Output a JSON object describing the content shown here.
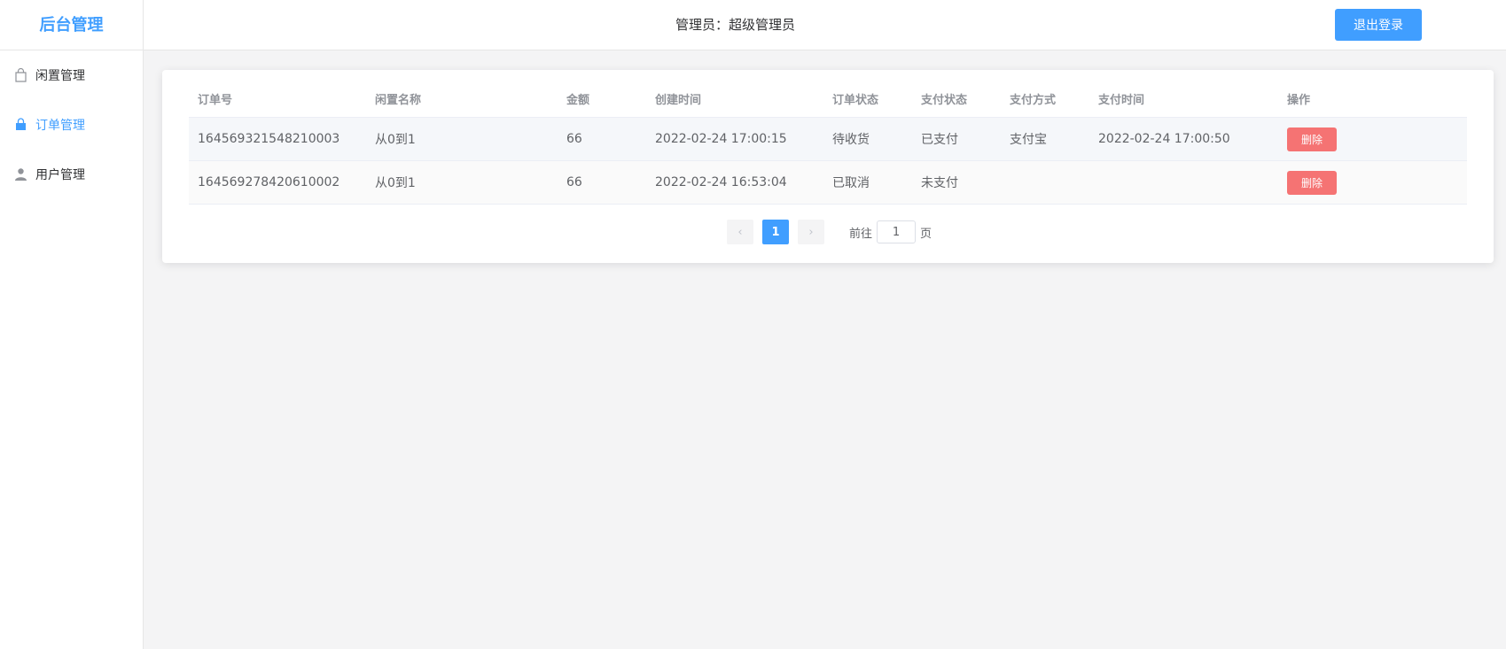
{
  "sidebar": {
    "title": "后台管理",
    "items": [
      {
        "label": "闲置管理",
        "icon": "shopping-bag-icon",
        "active": false
      },
      {
        "label": "订单管理",
        "icon": "shopping-bag-filled-icon",
        "active": true
      },
      {
        "label": "用户管理",
        "icon": "user-icon",
        "active": false
      }
    ]
  },
  "header": {
    "admin_label": "管理员：超级管理员",
    "logout_label": "退出登录"
  },
  "table": {
    "columns": [
      "订单号",
      "闲置名称",
      "金额",
      "创建时间",
      "订单状态",
      "支付状态",
      "支付方式",
      "支付时间",
      "操作"
    ],
    "rows": [
      {
        "order_no": "164569321548210003",
        "item_name": "从0到1",
        "amount": "66",
        "created": "2022-02-24 17:00:15",
        "order_status": "待收货",
        "pay_status": "已支付",
        "pay_method": "支付宝",
        "pay_time": "2022-02-24 17:00:50",
        "action": "删除"
      },
      {
        "order_no": "164569278420610002",
        "item_name": "从0到1",
        "amount": "66",
        "created": "2022-02-24 16:53:04",
        "order_status": "已取消",
        "pay_status": "未支付",
        "pay_method": "",
        "pay_time": "",
        "action": "删除"
      }
    ]
  },
  "pagination": {
    "prev": "‹",
    "current": "1",
    "next": "›",
    "goto_label": "前往",
    "goto_value": "1",
    "page_suffix": "页"
  },
  "colors": {
    "primary": "#409eff",
    "danger": "#f56c6c",
    "background": "#f4f4f5"
  }
}
